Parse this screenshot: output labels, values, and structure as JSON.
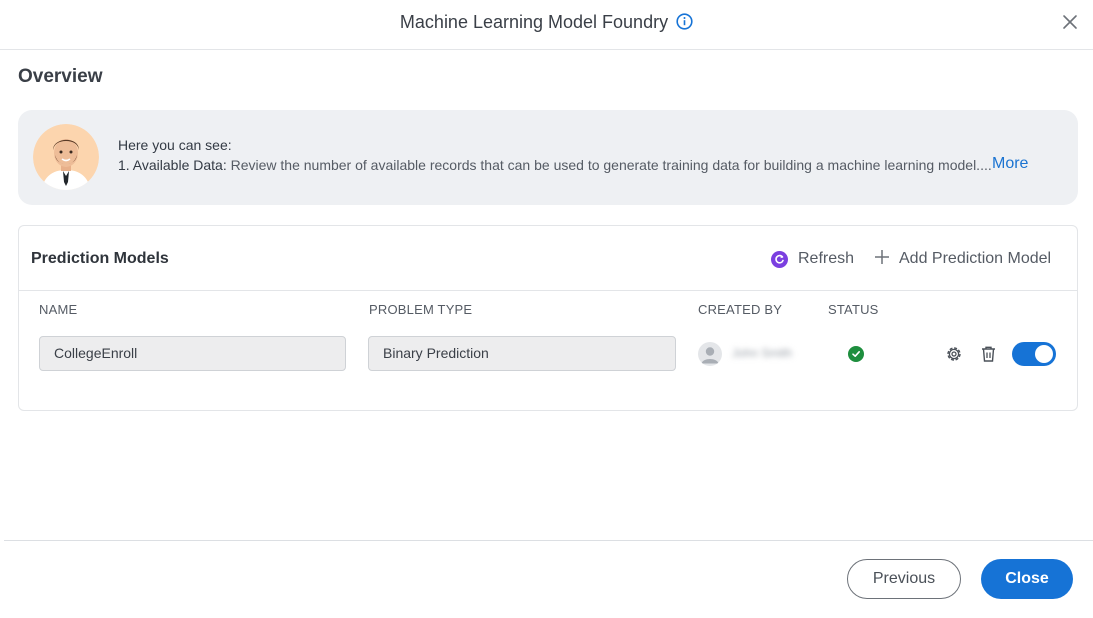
{
  "dialog": {
    "title": "Machine Learning Model Foundry",
    "info_icon": "info-icon",
    "close_icon": "close-icon"
  },
  "overview": {
    "title": "Overview",
    "intro_line1": "Here you can see:",
    "intro_line2_lead": "1. Available Data:",
    "intro_line2_rest": " Review the number of available records that can be used to generate training data for building a machine learning model....",
    "more_label": "More"
  },
  "models": {
    "title": "Prediction Models",
    "refresh_label": "Refresh",
    "add_label": "Add Prediction Model",
    "columns": {
      "name": "NAME",
      "problem_type": "PROBLEM TYPE",
      "created_by": "CREATED BY",
      "status": "STATUS"
    },
    "rows": [
      {
        "name": "CollegeEnroll",
        "problem_type": "Binary Prediction",
        "created_by": "John Smith",
        "status": "success",
        "enabled": true
      }
    ]
  },
  "footer": {
    "previous_label": "Previous",
    "close_label": "Close"
  },
  "colors": {
    "accent": "#1673d6",
    "link": "#1a73d1",
    "refresh_icon": "#7b3fe0",
    "status_ok": "#1e8e3e"
  }
}
